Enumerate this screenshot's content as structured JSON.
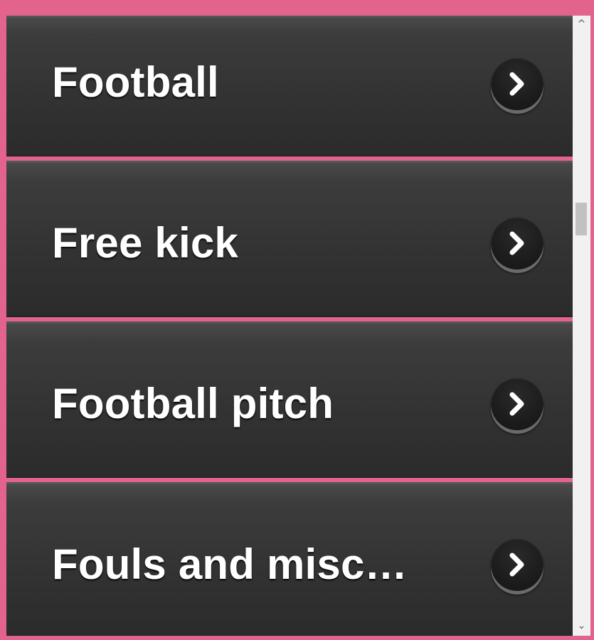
{
  "list": {
    "items": [
      {
        "label": "Football",
        "icon": "chevron-right-icon"
      },
      {
        "label": "Free kick",
        "icon": "chevron-right-icon"
      },
      {
        "label": "Football pitch",
        "icon": "chevron-right-icon"
      },
      {
        "label": "Fouls and misc…",
        "icon": "chevron-right-icon"
      }
    ]
  },
  "scrollbar": {
    "up_arrow": "^",
    "down_arrow": "⌄"
  },
  "colors": {
    "frame": "#e2648d",
    "item_background": "#333333",
    "label_text": "#ffffff",
    "chevron_button": "#1c1c1c"
  }
}
